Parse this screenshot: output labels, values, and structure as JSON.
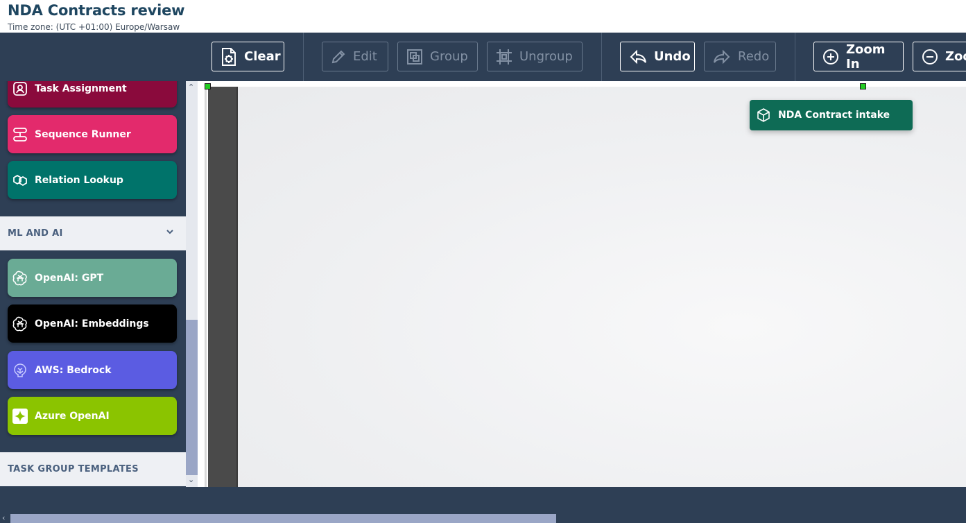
{
  "header": {
    "title": "NDA Contracts review",
    "timezone": "Time zone: (UTC +01:00) Europe/Warsaw"
  },
  "toolbar": {
    "clear": "Clear",
    "edit": "Edit",
    "group": "Group",
    "ungroup": "Ungroup",
    "undo": "Undo",
    "redo": "Redo",
    "zoom_in": "Zoom In",
    "zoom_out": "Zoo"
  },
  "sidebar": {
    "items_top": [
      {
        "label": "Task Assignment",
        "color": "#8a0a3c",
        "icon": "user-search-icon"
      },
      {
        "label": "Sequence Runner",
        "color": "#e32a6c",
        "icon": "sequence-icon"
      },
      {
        "label": "Relation Lookup",
        "color": "#00736a",
        "icon": "relation-icon"
      }
    ],
    "section_ml": "ML AND AI",
    "items_ml": [
      {
        "label": "OpenAI: GPT",
        "color": "#6aab95",
        "icon": "openai-icon"
      },
      {
        "label": "OpenAI: Embeddings",
        "color": "#000000",
        "icon": "openai-icon"
      },
      {
        "label": "AWS: Bedrock",
        "color": "#5b5ce2",
        "icon": "bedrock-icon"
      },
      {
        "label": "Azure OpenAI",
        "color": "#8bc400",
        "icon": "azure-sparkle-icon"
      }
    ],
    "section_templates": "TASK GROUP TEMPLATES"
  },
  "canvas": {
    "node_label": "NDA Contract intake",
    "node_color": "#0e6b55"
  }
}
